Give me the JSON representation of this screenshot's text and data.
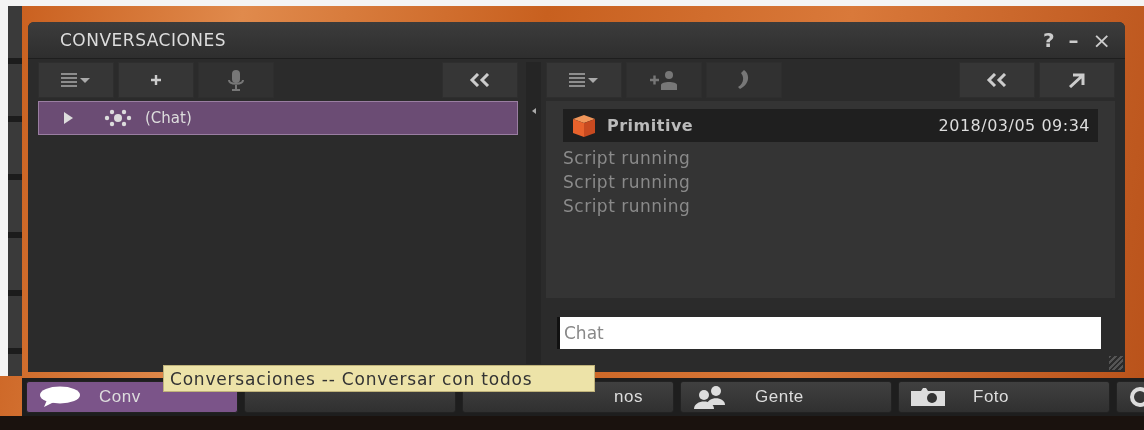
{
  "window": {
    "title": "CONVERSACIONES",
    "controls": [
      {
        "kind": "help",
        "label": "?"
      },
      {
        "kind": "minimize",
        "label": "–"
      },
      {
        "kind": "close",
        "label": "×"
      }
    ]
  },
  "left_toolbar": [
    {
      "kind": "menu",
      "disabled": false
    },
    {
      "kind": "add",
      "disabled": false
    },
    {
      "kind": "voice",
      "disabled": true
    },
    {
      "kind": "collapse",
      "disabled": false
    }
  ],
  "conversations": [
    {
      "label": "(Chat)",
      "selected": true,
      "expanded": false
    }
  ],
  "right_toolbar": [
    {
      "kind": "menu",
      "disabled": false
    },
    {
      "kind": "add-person",
      "disabled": true
    },
    {
      "kind": "call",
      "disabled": true
    },
    {
      "kind": "collapse",
      "disabled": false
    },
    {
      "kind": "tear-off",
      "disabled": false
    }
  ],
  "chat": {
    "sender": "Primitive",
    "time": "2018/03/05 09:34",
    "messages": [
      "Script running",
      "Script running",
      "Script running"
    ],
    "input": {
      "placeholder": "Chat"
    }
  },
  "bottom_toolbar": [
    {
      "kind": "chat",
      "label": "Conv",
      "selected": true
    },
    {
      "kind": "hidden",
      "selected": false
    },
    {
      "kind": "plain",
      "label": "nos",
      "selected": false
    },
    {
      "kind": "people",
      "label": "Gente",
      "selected": false
    },
    {
      "kind": "camera",
      "label": "Foto",
      "selected": false
    },
    {
      "kind": "search",
      "selected": false
    }
  ],
  "tooltip": {
    "text": "Conversaciones -- Conversar con todos"
  }
}
